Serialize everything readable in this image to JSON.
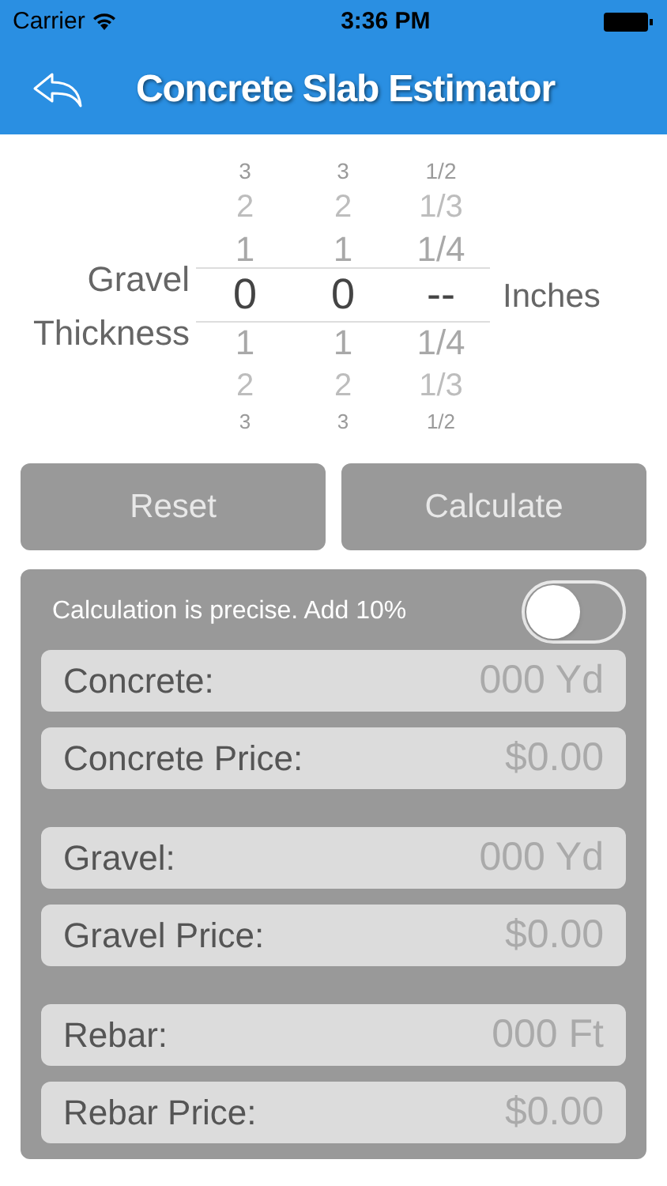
{
  "status_bar": {
    "carrier": "Carrier",
    "time": "3:36 PM"
  },
  "nav": {
    "title": "Concrete Slab Estimator"
  },
  "picker": {
    "label": "Gravel Thickness",
    "unit": "Inches",
    "columns": [
      {
        "above": [
          "3",
          "2",
          "1"
        ],
        "value": "0",
        "below": [
          "1",
          "2",
          "3"
        ]
      },
      {
        "above": [
          "3",
          "2",
          "1"
        ],
        "value": "0",
        "below": [
          "1",
          "2",
          "3"
        ]
      },
      {
        "above": [
          "1/2",
          "1/3",
          "1/4"
        ],
        "value": "--",
        "below": [
          "1/4",
          "1/3",
          "1/2"
        ]
      }
    ]
  },
  "buttons": [
    "Reset",
    "Calculate"
  ],
  "precise": {
    "label": "Calculation is precise. Add 10%",
    "on": false
  },
  "groups": [
    [
      {
        "label": "Concrete:",
        "value": "000 Yd"
      },
      {
        "label": "Concrete Price:",
        "value": "$0.00"
      }
    ],
    [
      {
        "label": "Gravel:",
        "value": "000 Yd"
      },
      {
        "label": "Gravel Price:",
        "value": "$0.00"
      }
    ],
    [
      {
        "label": "Rebar:",
        "value": "000 Ft"
      },
      {
        "label": "Rebar Price:",
        "value": "$0.00"
      }
    ]
  ]
}
